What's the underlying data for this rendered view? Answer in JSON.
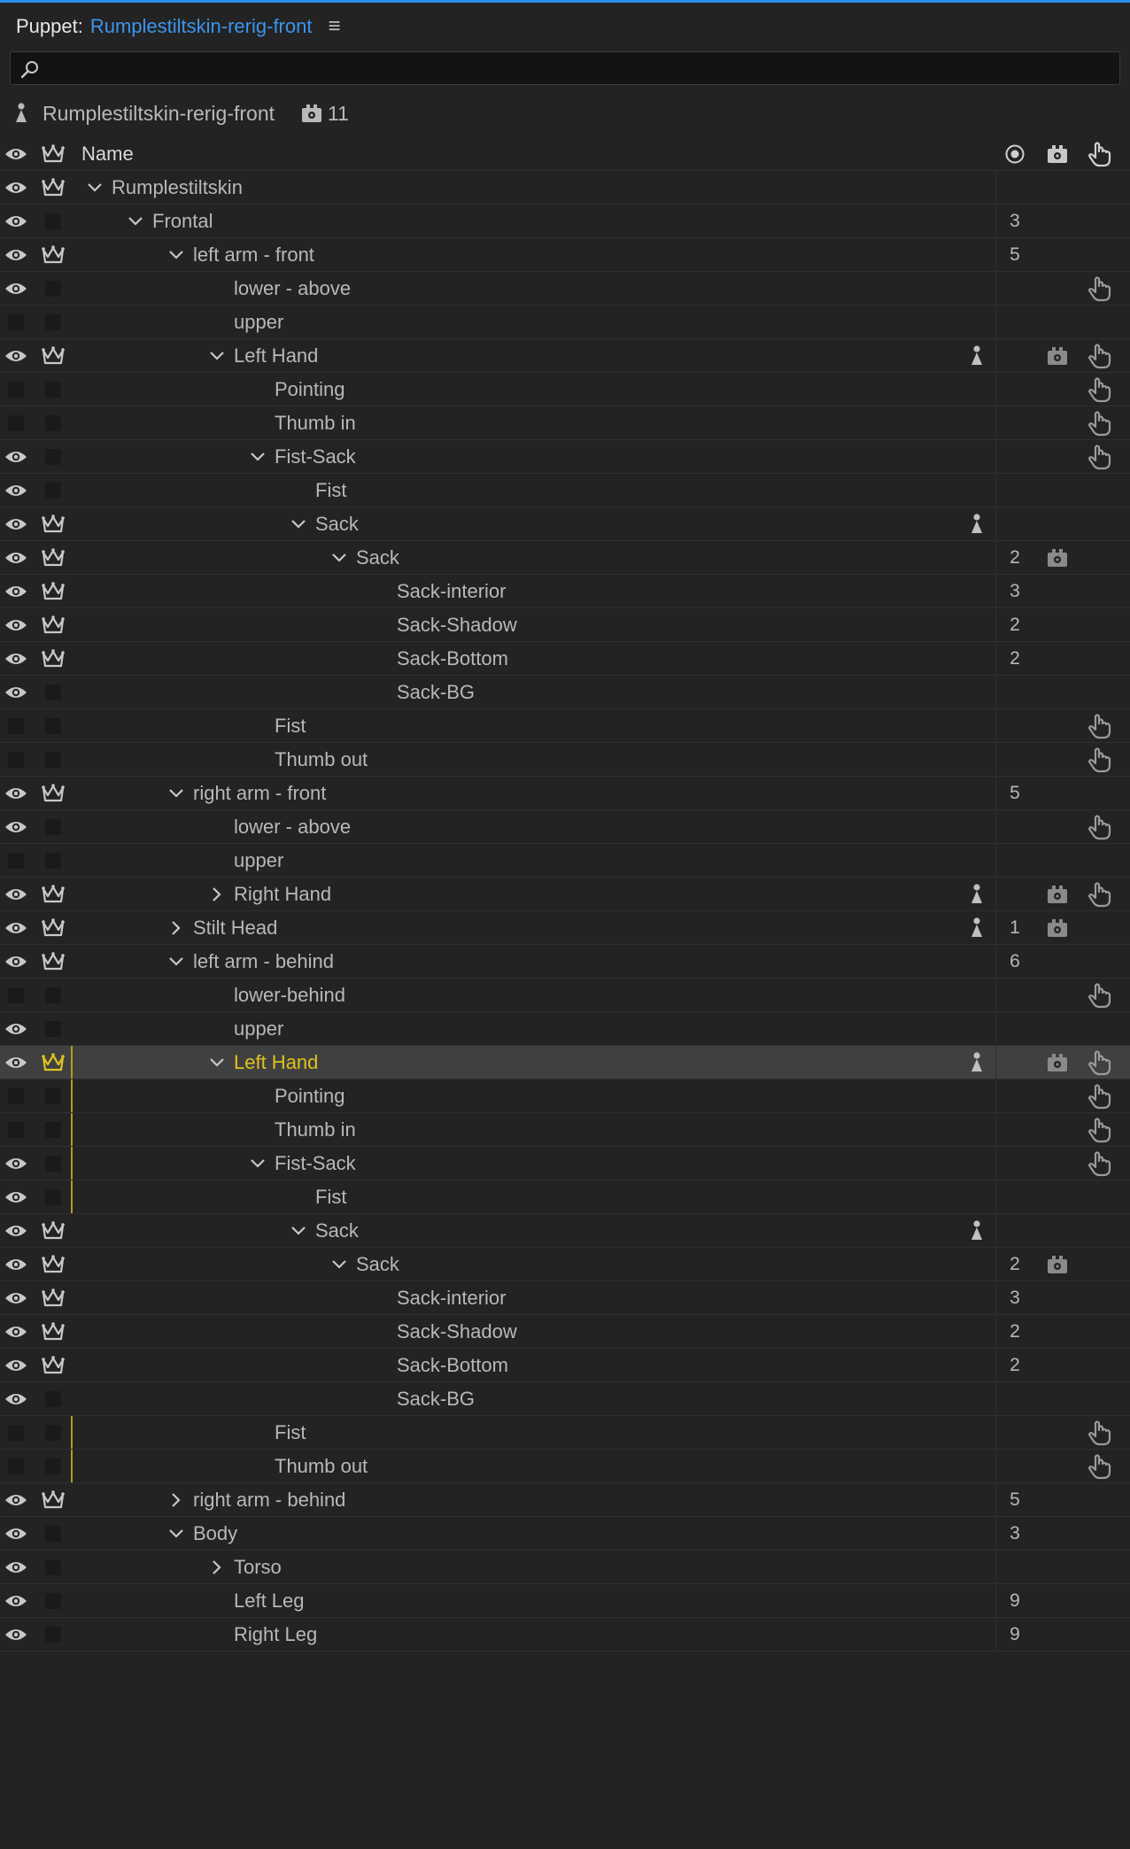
{
  "panel": {
    "label": "Puppet:",
    "puppet_name": "Rumplestiltskin-rerig-front",
    "menu_icon": "hamburger-menu-icon"
  },
  "search": {
    "placeholder": "",
    "value": ""
  },
  "puppet_info": {
    "name": "Rumplestiltskin-rerig-front",
    "trigger_count": "11"
  },
  "columns": {
    "name": "Name"
  },
  "colors": {
    "accent": "#3b95ee",
    "selected_text": "#e0c220",
    "background": "#232323"
  },
  "rows": [
    {
      "label": "Rumplestiltskin",
      "depth": 0,
      "chev": "down",
      "eye": true,
      "crown": true,
      "count": "",
      "pin": false,
      "trig": false,
      "hand": false
    },
    {
      "label": "Frontal",
      "depth": 1,
      "chev": "down",
      "eye": true,
      "crown": false,
      "count": "3",
      "pin": false,
      "trig": false,
      "hand": false
    },
    {
      "label": "left arm - front",
      "depth": 2,
      "chev": "down",
      "eye": true,
      "crown": true,
      "count": "5",
      "pin": false,
      "trig": false,
      "hand": false
    },
    {
      "label": "lower - above",
      "depth": 3,
      "chev": "",
      "eye": true,
      "crown": false,
      "count": "",
      "pin": false,
      "trig": false,
      "hand": true
    },
    {
      "label": "upper",
      "depth": 3,
      "chev": "",
      "eye": false,
      "crown": false,
      "count": "",
      "pin": false,
      "trig": false,
      "hand": false
    },
    {
      "label": "Left Hand",
      "depth": 3,
      "chev": "down",
      "eye": true,
      "crown": true,
      "count": "",
      "pin": true,
      "trig": true,
      "hand": true
    },
    {
      "label": "Pointing",
      "depth": 4,
      "chev": "",
      "eye": false,
      "crown": false,
      "count": "",
      "pin": false,
      "trig": false,
      "hand": true
    },
    {
      "label": "Thumb in",
      "depth": 4,
      "chev": "",
      "eye": false,
      "crown": false,
      "count": "",
      "pin": false,
      "trig": false,
      "hand": true
    },
    {
      "label": "Fist-Sack",
      "depth": 4,
      "chev": "down",
      "eye": true,
      "crown": false,
      "count": "",
      "pin": false,
      "trig": false,
      "hand": true
    },
    {
      "label": "Fist",
      "depth": 5,
      "chev": "",
      "eye": true,
      "crown": false,
      "count": "",
      "pin": false,
      "trig": false,
      "hand": false
    },
    {
      "label": "Sack",
      "depth": 5,
      "chev": "down",
      "eye": true,
      "crown": true,
      "count": "",
      "pin": true,
      "trig": false,
      "hand": false
    },
    {
      "label": "Sack",
      "depth": 6,
      "chev": "down",
      "eye": true,
      "crown": true,
      "count": "2",
      "pin": false,
      "trig": true,
      "hand": false
    },
    {
      "label": "Sack-interior",
      "depth": 7,
      "chev": "",
      "eye": true,
      "crown": true,
      "count": "3",
      "pin": false,
      "trig": false,
      "hand": false
    },
    {
      "label": "Sack-Shadow",
      "depth": 7,
      "chev": "",
      "eye": true,
      "crown": true,
      "count": "2",
      "pin": false,
      "trig": false,
      "hand": false
    },
    {
      "label": "Sack-Bottom",
      "depth": 7,
      "chev": "",
      "eye": true,
      "crown": true,
      "count": "2",
      "pin": false,
      "trig": false,
      "hand": false
    },
    {
      "label": "Sack-BG",
      "depth": 7,
      "chev": "",
      "eye": true,
      "crown": false,
      "count": "",
      "pin": false,
      "trig": false,
      "hand": false
    },
    {
      "label": "Fist",
      "depth": 4,
      "chev": "",
      "eye": false,
      "crown": false,
      "count": "",
      "pin": false,
      "trig": false,
      "hand": true
    },
    {
      "label": "Thumb out",
      "depth": 4,
      "chev": "",
      "eye": false,
      "crown": false,
      "count": "",
      "pin": false,
      "trig": false,
      "hand": true
    },
    {
      "label": "right arm - front",
      "depth": 2,
      "chev": "down",
      "eye": true,
      "crown": true,
      "count": "5",
      "pin": false,
      "trig": false,
      "hand": false
    },
    {
      "label": "lower - above",
      "depth": 3,
      "chev": "",
      "eye": true,
      "crown": false,
      "count": "",
      "pin": false,
      "trig": false,
      "hand": true
    },
    {
      "label": "upper",
      "depth": 3,
      "chev": "",
      "eye": false,
      "crown": false,
      "count": "",
      "pin": false,
      "trig": false,
      "hand": false
    },
    {
      "label": "Right Hand",
      "depth": 3,
      "chev": "right",
      "eye": true,
      "crown": true,
      "count": "",
      "pin": true,
      "trig": true,
      "hand": true
    },
    {
      "label": "Stilt Head",
      "depth": 2,
      "chev": "right",
      "eye": true,
      "crown": true,
      "count": "1",
      "pin": true,
      "trig": true,
      "hand": false
    },
    {
      "label": "left arm - behind",
      "depth": 2,
      "chev": "down",
      "eye": true,
      "crown": true,
      "count": "6",
      "pin": false,
      "trig": false,
      "hand": false
    },
    {
      "label": "lower-behind",
      "depth": 3,
      "chev": "",
      "eye": false,
      "crown": false,
      "count": "",
      "pin": false,
      "trig": false,
      "hand": true
    },
    {
      "label": "upper",
      "depth": 3,
      "chev": "",
      "eye": true,
      "crown": false,
      "count": "",
      "pin": false,
      "trig": false,
      "hand": false
    },
    {
      "label": "Left Hand",
      "depth": 3,
      "chev": "down",
      "eye": true,
      "crown": true,
      "count": "",
      "pin": true,
      "trig": true,
      "hand": true,
      "selected": true
    },
    {
      "label": "Pointing",
      "depth": 4,
      "chev": "",
      "eye": false,
      "crown": false,
      "count": "",
      "pin": false,
      "trig": false,
      "hand": true,
      "yline": true
    },
    {
      "label": "Thumb in",
      "depth": 4,
      "chev": "",
      "eye": false,
      "crown": false,
      "count": "",
      "pin": false,
      "trig": false,
      "hand": true,
      "yline": true
    },
    {
      "label": "Fist-Sack",
      "depth": 4,
      "chev": "down",
      "eye": true,
      "crown": false,
      "count": "",
      "pin": false,
      "trig": false,
      "hand": true,
      "yline": true
    },
    {
      "label": "Fist",
      "depth": 5,
      "chev": "",
      "eye": true,
      "crown": false,
      "count": "",
      "pin": false,
      "trig": false,
      "hand": false,
      "yline": true
    },
    {
      "label": "Sack",
      "depth": 5,
      "chev": "down",
      "eye": true,
      "crown": true,
      "count": "",
      "pin": true,
      "trig": false,
      "hand": false
    },
    {
      "label": "Sack",
      "depth": 6,
      "chev": "down",
      "eye": true,
      "crown": true,
      "count": "2",
      "pin": false,
      "trig": true,
      "hand": false
    },
    {
      "label": "Sack-interior",
      "depth": 7,
      "chev": "",
      "eye": true,
      "crown": true,
      "count": "3",
      "pin": false,
      "trig": false,
      "hand": false
    },
    {
      "label": "Sack-Shadow",
      "depth": 7,
      "chev": "",
      "eye": true,
      "crown": true,
      "count": "2",
      "pin": false,
      "trig": false,
      "hand": false
    },
    {
      "label": "Sack-Bottom",
      "depth": 7,
      "chev": "",
      "eye": true,
      "crown": true,
      "count": "2",
      "pin": false,
      "trig": false,
      "hand": false
    },
    {
      "label": "Sack-BG",
      "depth": 7,
      "chev": "",
      "eye": true,
      "crown": false,
      "count": "",
      "pin": false,
      "trig": false,
      "hand": false
    },
    {
      "label": "Fist",
      "depth": 4,
      "chev": "",
      "eye": false,
      "crown": false,
      "count": "",
      "pin": false,
      "trig": false,
      "hand": true,
      "yline": true
    },
    {
      "label": "Thumb out",
      "depth": 4,
      "chev": "",
      "eye": false,
      "crown": false,
      "count": "",
      "pin": false,
      "trig": false,
      "hand": true,
      "yline": true
    },
    {
      "label": "right arm - behind",
      "depth": 2,
      "chev": "right",
      "eye": true,
      "crown": true,
      "count": "5",
      "pin": false,
      "trig": false,
      "hand": false
    },
    {
      "label": "Body",
      "depth": 2,
      "chev": "down",
      "eye": true,
      "crown": false,
      "count": "3",
      "pin": false,
      "trig": false,
      "hand": false
    },
    {
      "label": "Torso",
      "depth": 3,
      "chev": "right",
      "eye": true,
      "crown": false,
      "count": "",
      "pin": false,
      "trig": false,
      "hand": false
    },
    {
      "label": "Left Leg",
      "depth": 3,
      "chev": "",
      "eye": true,
      "crown": false,
      "count": "9",
      "pin": false,
      "trig": false,
      "hand": false
    },
    {
      "label": "Right Leg",
      "depth": 3,
      "chev": "",
      "eye": true,
      "crown": false,
      "count": "9",
      "pin": false,
      "trig": false,
      "hand": false
    }
  ]
}
